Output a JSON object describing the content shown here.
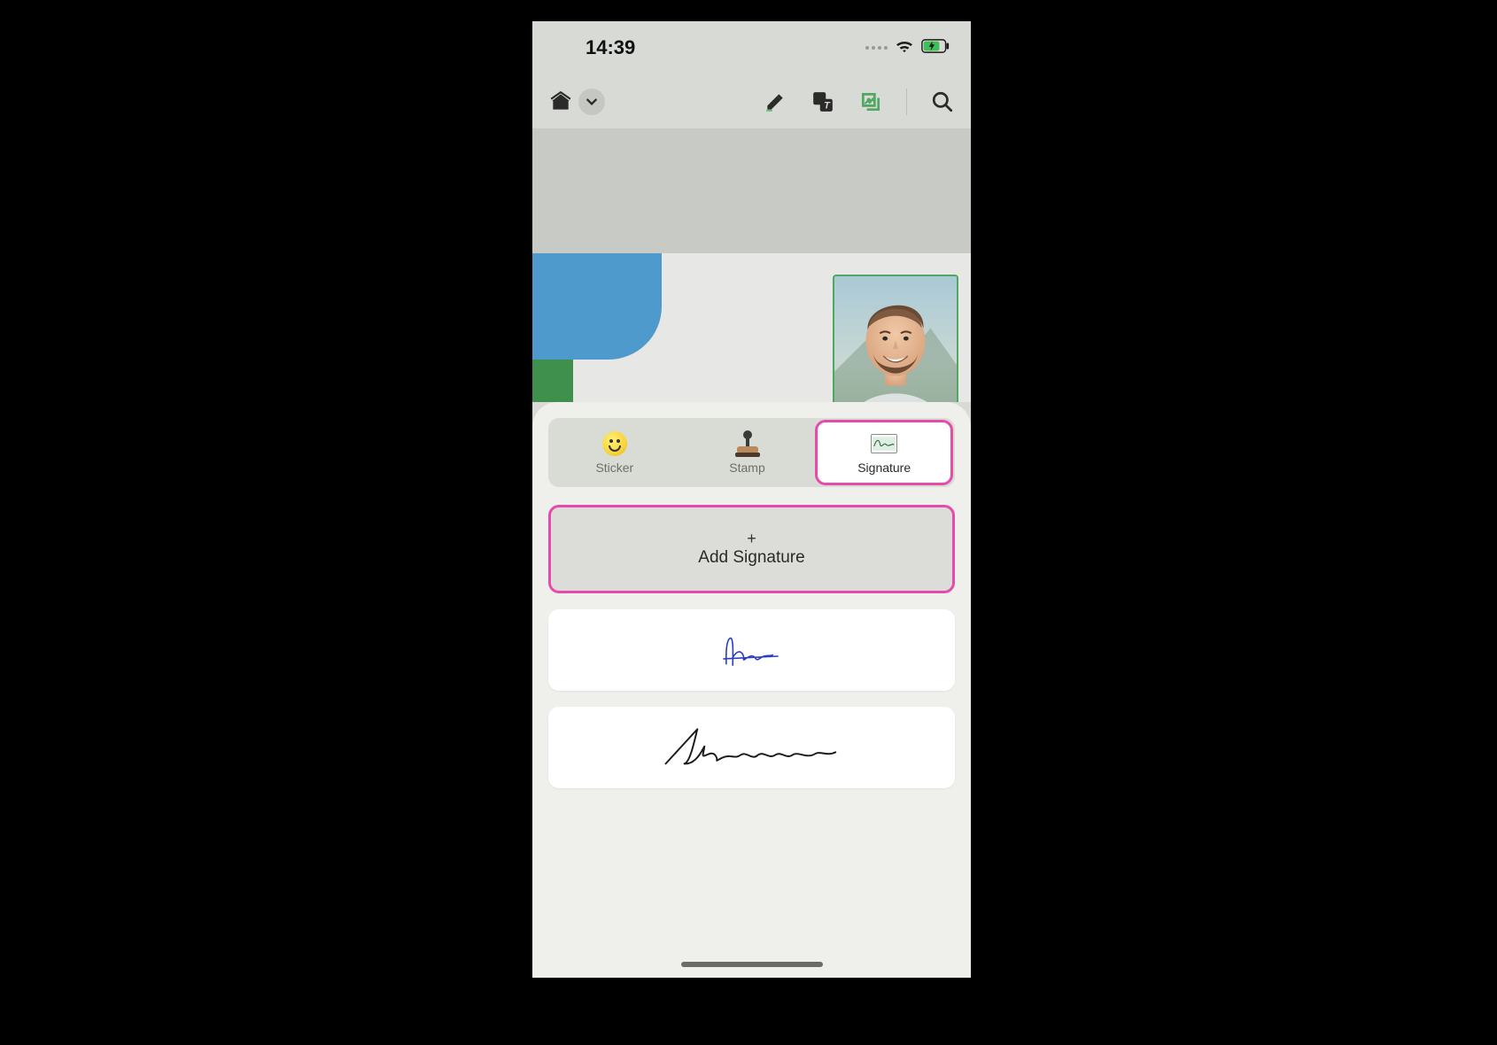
{
  "status": {
    "time": "14:39"
  },
  "tabs": {
    "sticker": "Sticker",
    "stamp": "Stamp",
    "signature": "Signature"
  },
  "add_button": {
    "plus": "+",
    "label": "Add Signature"
  },
  "colors": {
    "highlight": "#e64bac",
    "accent_green": "#4fa860"
  }
}
